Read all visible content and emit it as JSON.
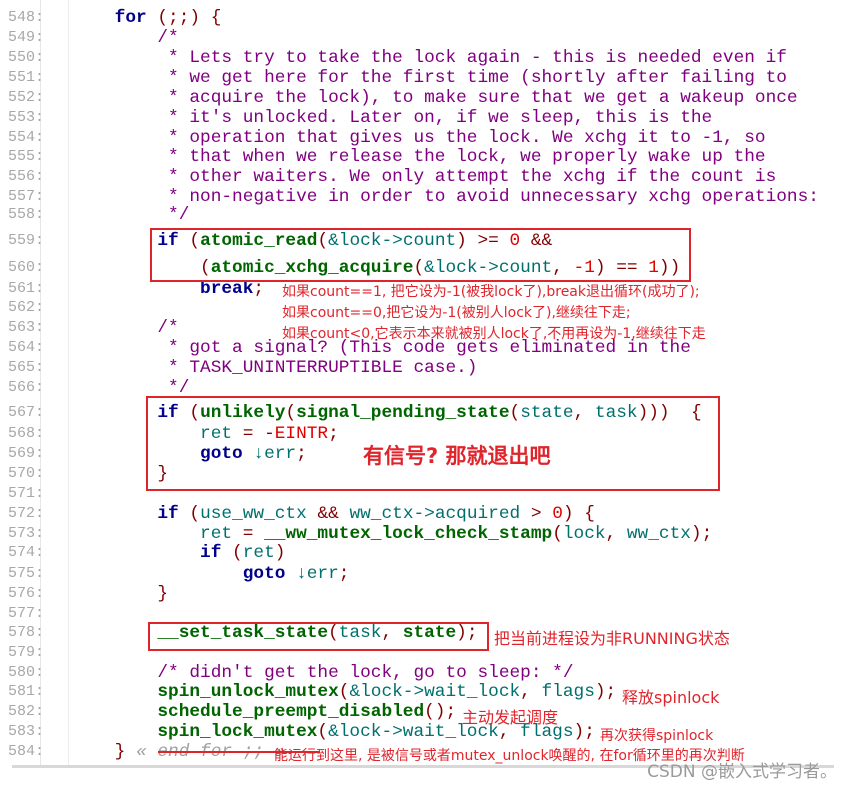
{
  "colors": {
    "keyword": "#00008b",
    "function": "#006400",
    "comment": "#800080",
    "identifier": "#00706e",
    "number": "#e00000",
    "annotation": "#e0242c",
    "line_number": "#a8a8a8"
  },
  "lines": [
    {
      "n": "548:",
      "t": [
        [
          "kw",
          "    for"
        ],
        [
          "op",
          " (;;) {"
        ]
      ]
    },
    {
      "n": "549:",
      "t": [
        [
          "cm",
          "        /*"
        ]
      ]
    },
    {
      "n": "550:",
      "t": [
        [
          "cm",
          "         * Lets try to take the lock again - this is needed even if"
        ]
      ]
    },
    {
      "n": "551:",
      "t": [
        [
          "cm",
          "         * we get here for the first time (shortly after failing to"
        ]
      ]
    },
    {
      "n": "552:",
      "t": [
        [
          "cm",
          "         * acquire the lock), to make sure that we get a wakeup once"
        ]
      ]
    },
    {
      "n": "553:",
      "t": [
        [
          "cm",
          "         * it's unlocked. Later on, if we sleep, this is the"
        ]
      ]
    },
    {
      "n": "554:",
      "t": [
        [
          "cm",
          "         * operation that gives us the lock. We xchg it to -1, so"
        ]
      ]
    },
    {
      "n": "555:",
      "t": [
        [
          "cm",
          "         * that when we release the lock, we properly wake up the"
        ]
      ]
    },
    {
      "n": "556:",
      "t": [
        [
          "cm",
          "         * other waiters. We only attempt the xchg if the count is"
        ]
      ]
    },
    {
      "n": "557:",
      "t": [
        [
          "cm",
          "         * non-negative in order to avoid unnecessary xchg operations:"
        ]
      ]
    },
    {
      "n": "558:",
      "t": [
        [
          "cm",
          "         */"
        ]
      ]
    },
    {
      "n": "559:",
      "t": [
        [
          "kw",
          "        if"
        ],
        [
          "op",
          " ("
        ],
        [
          "fn",
          "atomic_read"
        ],
        [
          "op",
          "("
        ],
        [
          "id",
          "&lock->count"
        ],
        [
          "op",
          ") >= "
        ],
        [
          "num",
          "0"
        ],
        [
          "op",
          " &&"
        ]
      ]
    },
    {
      "n": "560:",
      "t": [
        [
          "op",
          "            ("
        ],
        [
          "fn",
          "atomic_xchg_acquire"
        ],
        [
          "op",
          "("
        ],
        [
          "id",
          "&lock->count"
        ],
        [
          "op",
          ", "
        ],
        [
          "num",
          "-1"
        ],
        [
          "op",
          ") == "
        ],
        [
          "num",
          "1"
        ],
        [
          "op",
          "))"
        ]
      ]
    },
    {
      "n": "561:",
      "t": [
        [
          "kw",
          "            break"
        ],
        [
          "op",
          ";"
        ]
      ]
    },
    {
      "n": "562:",
      "t": []
    },
    {
      "n": "563:",
      "t": [
        [
          "cm",
          "        /*"
        ]
      ]
    },
    {
      "n": "564:",
      "t": [
        [
          "cm",
          "         * got a signal? (This code gets eliminated in the"
        ]
      ]
    },
    {
      "n": "565:",
      "t": [
        [
          "cm",
          "         * TASK_UNINTERRUPTIBLE case.)"
        ]
      ]
    },
    {
      "n": "566:",
      "t": [
        [
          "cm",
          "         */"
        ]
      ]
    },
    {
      "n": "567:",
      "t": [
        [
          "kw",
          "        if"
        ],
        [
          "op",
          " ("
        ],
        [
          "fn",
          "unlikely"
        ],
        [
          "op",
          "("
        ],
        [
          "fn",
          "signal_pending_state"
        ],
        [
          "op",
          "("
        ],
        [
          "id",
          "state"
        ],
        [
          "op",
          ", "
        ],
        [
          "id",
          "task"
        ],
        [
          "op",
          ")))  {"
        ]
      ]
    },
    {
      "n": "568:",
      "t": [
        [
          "id",
          "            ret"
        ],
        [
          "op",
          " = -"
        ],
        [
          "num",
          "EINTR"
        ],
        [
          "op",
          ";"
        ]
      ]
    },
    {
      "n": "569:",
      "t": [
        [
          "kw",
          "            goto"
        ],
        [
          "id",
          " ↓err"
        ],
        [
          "op",
          ";"
        ]
      ]
    },
    {
      "n": "570:",
      "t": [
        [
          "op",
          "        }"
        ]
      ]
    },
    {
      "n": "571:",
      "t": []
    },
    {
      "n": "572:",
      "t": [
        [
          "kw",
          "        if"
        ],
        [
          "op",
          " ("
        ],
        [
          "id",
          "use_ww_ctx"
        ],
        [
          "op",
          " && "
        ],
        [
          "id",
          "ww_ctx->acquired"
        ],
        [
          "op",
          " > "
        ],
        [
          "num",
          "0"
        ],
        [
          "op",
          ") {"
        ]
      ]
    },
    {
      "n": "573:",
      "t": [
        [
          "id",
          "            ret"
        ],
        [
          "op",
          " = "
        ],
        [
          "fn",
          "__ww_mutex_lock_check_stamp"
        ],
        [
          "op",
          "("
        ],
        [
          "id",
          "lock"
        ],
        [
          "op",
          ", "
        ],
        [
          "id",
          "ww_ctx"
        ],
        [
          "op",
          ");"
        ]
      ]
    },
    {
      "n": "574:",
      "t": [
        [
          "kw",
          "            if"
        ],
        [
          "op",
          " ("
        ],
        [
          "id",
          "ret"
        ],
        [
          "op",
          ")"
        ]
      ]
    },
    {
      "n": "575:",
      "t": [
        [
          "kw",
          "                goto"
        ],
        [
          "id",
          " ↓err"
        ],
        [
          "op",
          ";"
        ]
      ]
    },
    {
      "n": "576:",
      "t": [
        [
          "op",
          "        }"
        ]
      ]
    },
    {
      "n": "577:",
      "t": []
    },
    {
      "n": "578:",
      "t": [
        [
          "fn",
          "        __set_task_state"
        ],
        [
          "op",
          "("
        ],
        [
          "id",
          "task"
        ],
        [
          "op",
          ", "
        ],
        [
          "fn",
          "state"
        ],
        [
          "op",
          ");"
        ]
      ]
    },
    {
      "n": "579:",
      "t": []
    },
    {
      "n": "580:",
      "t": [
        [
          "cm",
          "        /* didn't get the lock, go to sleep: */"
        ]
      ]
    },
    {
      "n": "581:",
      "t": [
        [
          "fn",
          "        spin_unlock_mutex"
        ],
        [
          "op",
          "("
        ],
        [
          "id",
          "&lock->wait_lock"
        ],
        [
          "op",
          ", "
        ],
        [
          "id",
          "flags"
        ],
        [
          "op",
          ");"
        ]
      ]
    },
    {
      "n": "582:",
      "t": [
        [
          "fn",
          "        schedule_preempt_disabled"
        ],
        [
          "op",
          "();"
        ]
      ]
    },
    {
      "n": "583:",
      "t": [
        [
          "fn",
          "        spin_lock_mutex"
        ],
        [
          "op",
          "("
        ],
        [
          "id",
          "&lock->wait_lock"
        ],
        [
          "op",
          ", "
        ],
        [
          "id",
          "flags"
        ],
        [
          "op",
          ");"
        ]
      ]
    },
    {
      "n": "584:",
      "t": [
        [
          "op",
          "    }"
        ],
        [
          "en",
          " « end for ;; »"
        ]
      ]
    }
  ],
  "annotations": {
    "break_1": "如果count==1, 把它设为-1(被我lock了),break退出循环(成功了);",
    "break_2": "如果count==0,把它设为-1(被别人lock了),继续往下走;",
    "break_3": "如果count<0,它表示本来就被别人lock了,不用再设为-1,继续往下走",
    "signal": "有信号? 那就退出吧",
    "set_state": "把当前进程设为非RUNNING状态",
    "unlock": "释放spinlock",
    "schedule": "主动发起调度",
    "relock": "再次获得spinlock",
    "end_for": "能运行到这里, 是被信号或者mutex_unlock唤醒的, 在for循环里的再次判断"
  },
  "watermark": "CSDN @嵌入式学习者。"
}
